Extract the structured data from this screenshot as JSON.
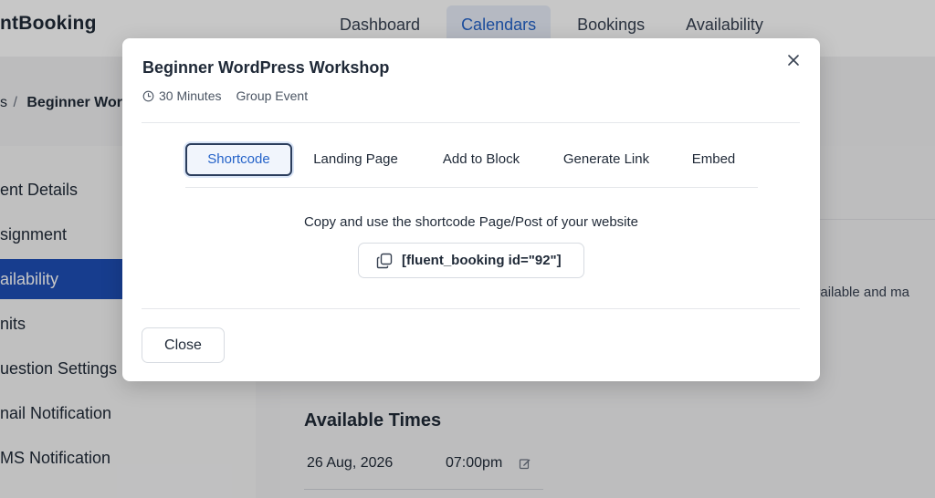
{
  "app": {
    "brand": "ntBooking",
    "nav": [
      "Dashboard",
      "Calendars",
      "Bookings",
      "Availability"
    ],
    "nav_active": "Calendars"
  },
  "breadcrumb": {
    "prev": "s",
    "separator": "/",
    "current": "Beginner Word"
  },
  "sidebar": {
    "items": [
      {
        "label": "ent Details"
      },
      {
        "label": "signment"
      },
      {
        "label": "ailability",
        "active": true
      },
      {
        "label": "nits"
      },
      {
        "label": "uestion Settings"
      },
      {
        "label": "nail Notification"
      },
      {
        "label": "MS Notification"
      }
    ]
  },
  "content": {
    "side_text": "n available and ma",
    "available_times_title": "Available Times",
    "rows": [
      {
        "date": "26 Aug, 2026",
        "time": "07:00pm"
      }
    ]
  },
  "modal": {
    "title": "Beginner WordPress Workshop",
    "duration": "30 Minutes",
    "event_type": "Group Event",
    "tabs": [
      "Shortcode",
      "Landing Page",
      "Add to Block",
      "Generate Link",
      "Embed"
    ],
    "active_tab": "Shortcode",
    "instruction": "Copy and use the shortcode Page/Post of your website",
    "shortcode": "[fluent_booking id=\"92\"]",
    "close_button": "Close"
  },
  "colors": {
    "accent": "#2563c9",
    "sidebar_active": "#1e4fb6"
  }
}
